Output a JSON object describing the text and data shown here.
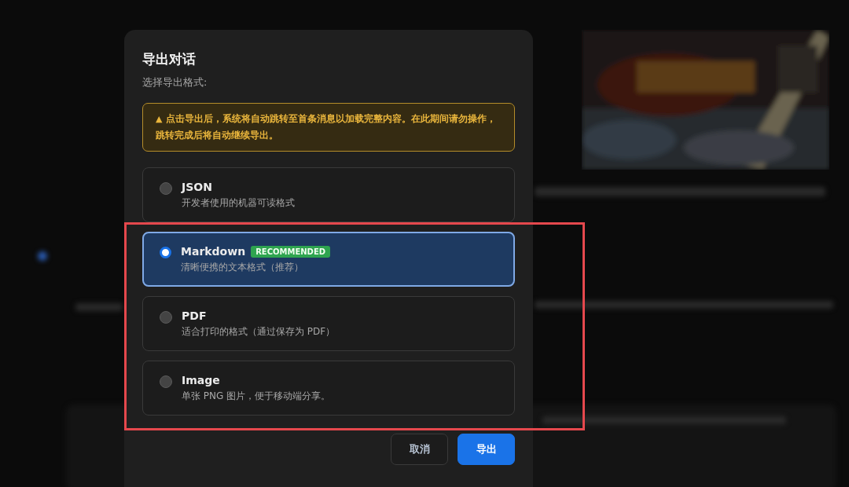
{
  "dialog": {
    "title": "导出对话",
    "subtitle": "选择导出格式:",
    "warning": {
      "icon": "▲",
      "text": "点击导出后，系统将自动跳转至首条消息以加载完整内容。在此期间请勿操作，跳转完成后将自动继续导出。"
    },
    "options": [
      {
        "name": "JSON",
        "description": "开发者使用的机器可读格式",
        "selected": false
      },
      {
        "name": "Markdown",
        "badge": "RECOMMENDED",
        "description": "清晰便携的文本格式（推荐）",
        "selected": true
      },
      {
        "name": "PDF",
        "description": "适合打印的格式（通过保存为 PDF）",
        "selected": false
      },
      {
        "name": "Image",
        "description": "单张 PNG 图片，便于移动端分享。",
        "selected": false
      }
    ],
    "buttons": [
      {
        "label": "取消",
        "kind": "secondary"
      },
      {
        "label": "导出",
        "kind": "primary"
      }
    ]
  },
  "annotation": {
    "kind": "highlight-rectangle"
  }
}
